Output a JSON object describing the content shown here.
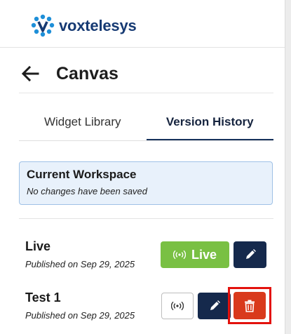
{
  "brand": {
    "name": "voxtelesys",
    "accent": "#163a73",
    "dot_color": "#1e8fd8"
  },
  "page": {
    "title": "Canvas",
    "back_icon": "arrow-left-icon"
  },
  "tabs": [
    {
      "label": "Widget Library",
      "active": false
    },
    {
      "label": "Version History",
      "active": true
    }
  ],
  "workspace": {
    "title": "Current Workspace",
    "subtitle": "No changes have been saved"
  },
  "versions": [
    {
      "name": "Live",
      "date": "Published on Sep 29, 2025",
      "live_label": "Live",
      "is_live": true
    },
    {
      "name": "Test 1",
      "date": "Published on Sep 29, 2025",
      "is_live": false
    }
  ],
  "colors": {
    "live_green": "#79c043",
    "navy": "#15294c",
    "delete_red": "#d93a1c",
    "highlight_red": "#e3120d"
  }
}
